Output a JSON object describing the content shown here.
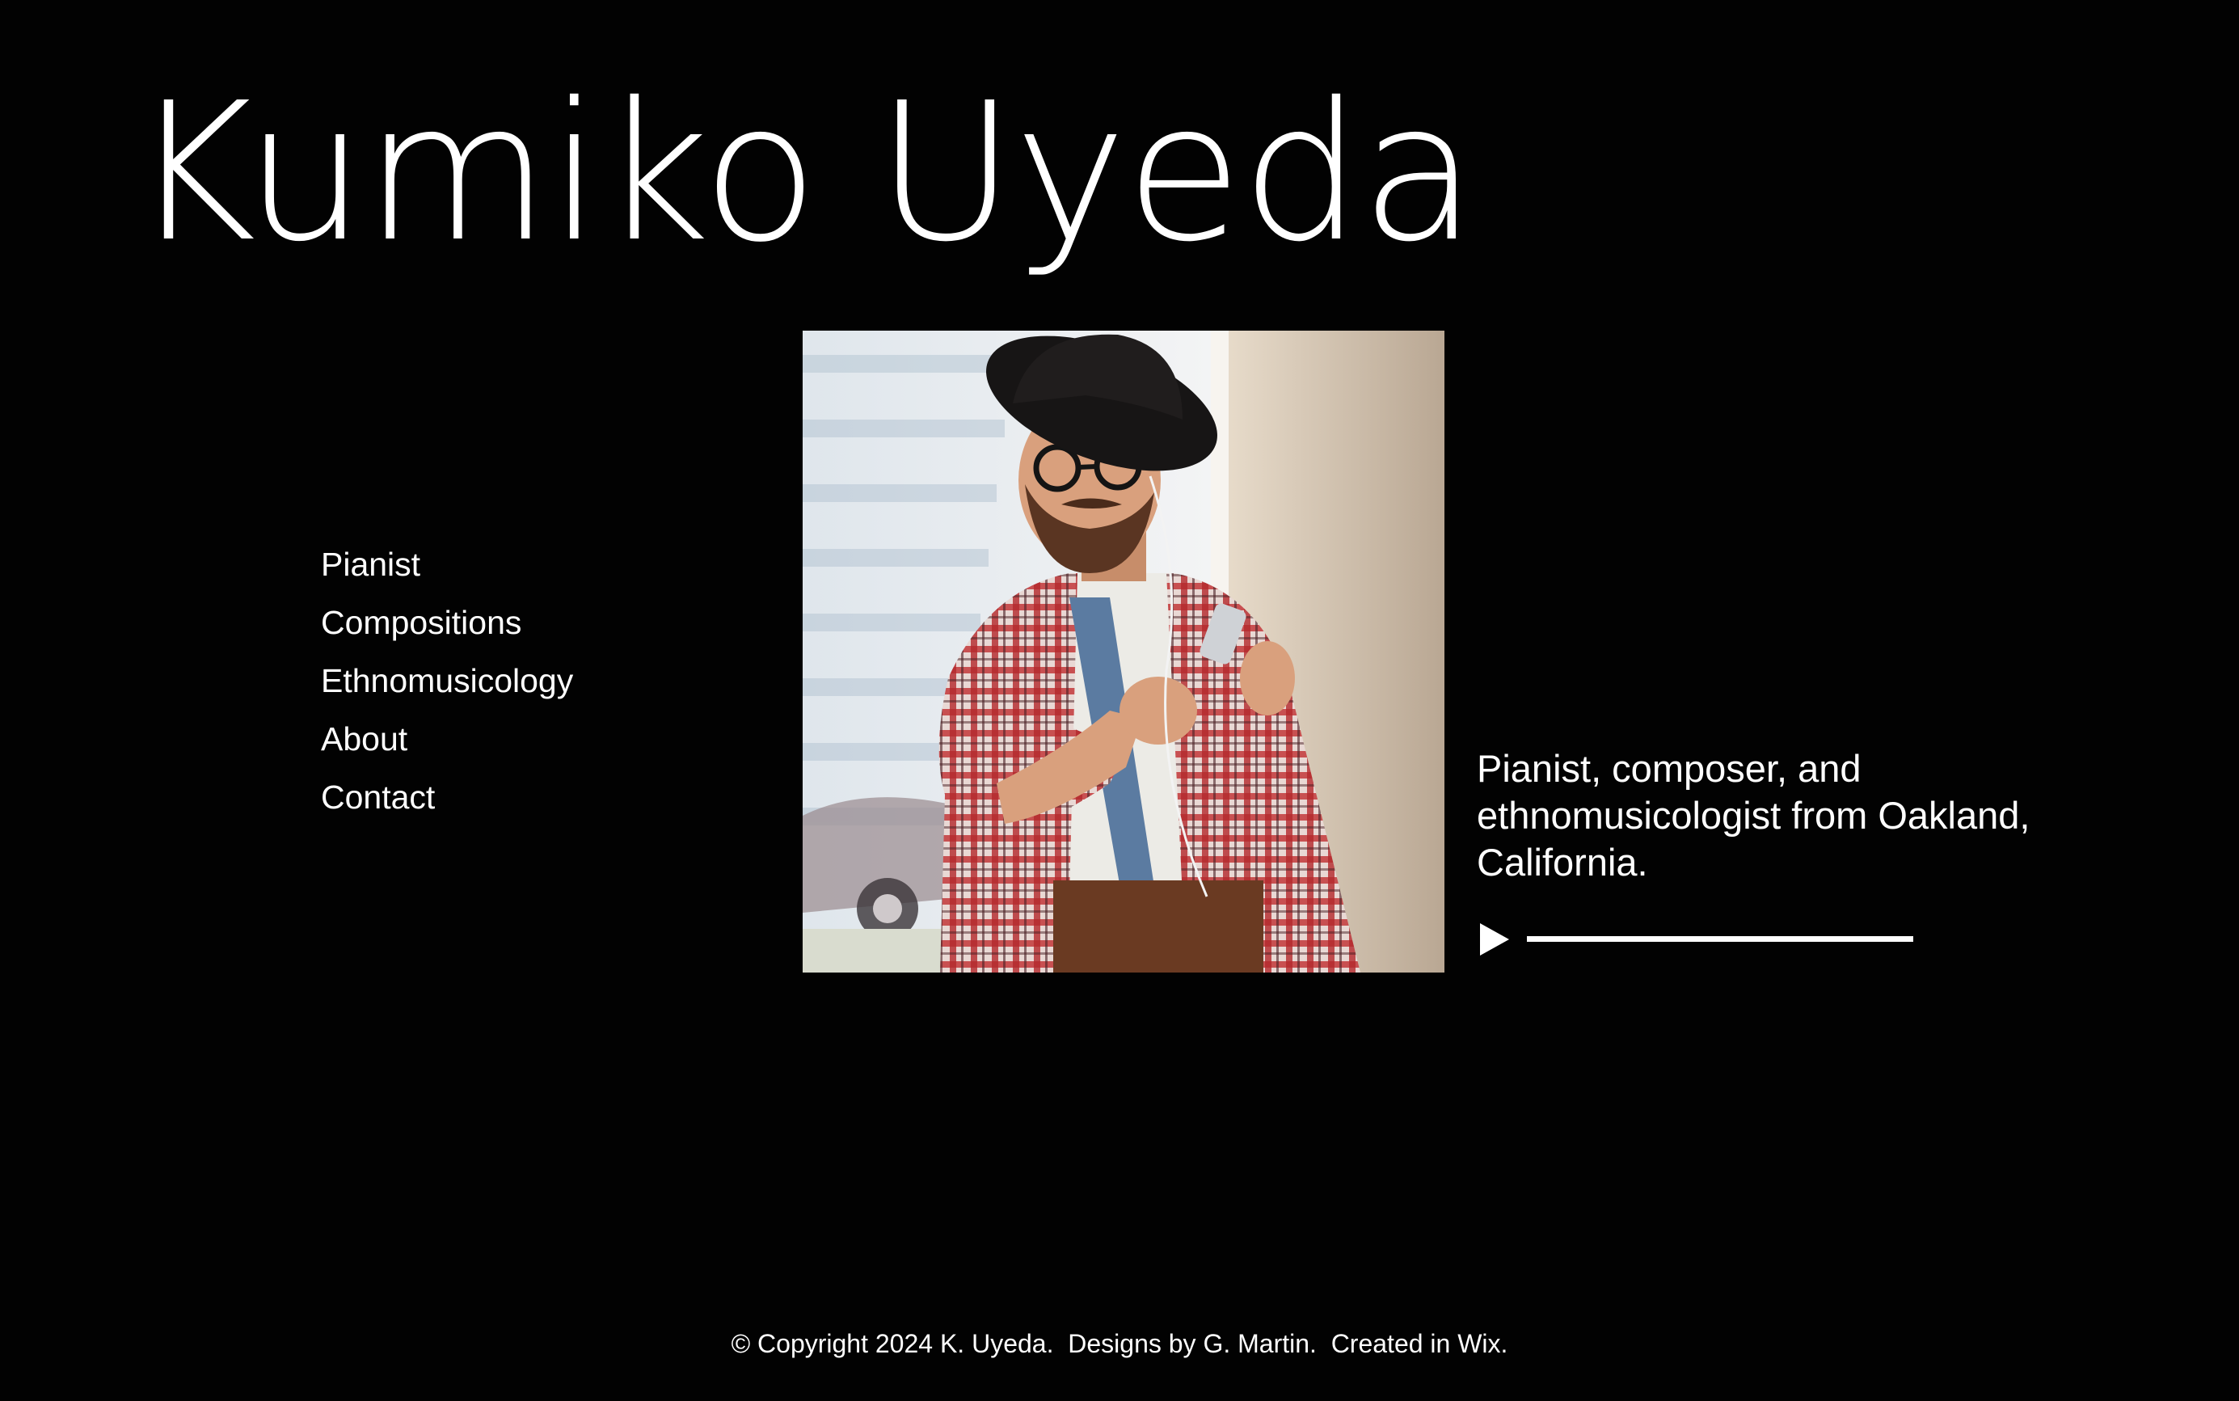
{
  "site": {
    "title": "Kumiko Uyeda"
  },
  "nav": {
    "items": [
      {
        "label": "Pianist"
      },
      {
        "label": "Compositions"
      },
      {
        "label": "Ethnomusicology"
      },
      {
        "label": "About"
      },
      {
        "label": "Contact"
      }
    ]
  },
  "hero": {
    "image_description": "portrait-photo",
    "tagline": "Pianist, composer, and ethnomusicologist from Oakland, California.",
    "audio": {
      "play_icon": "play-icon",
      "progress": 0
    }
  },
  "footer": {
    "text": "© Copyright 2024 K. Uyeda.  Designs by G. Martin.  Created in Wix."
  },
  "colors": {
    "background": "#020202",
    "text": "#ffffff"
  }
}
